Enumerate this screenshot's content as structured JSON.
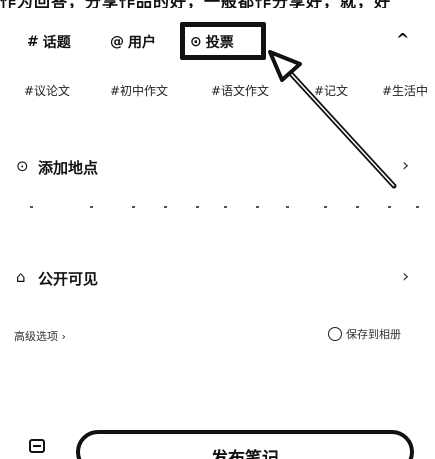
{
  "top_clip_text": "作为回答，分享作品的好，一般都作分享好，就，好",
  "toolbar": {
    "topic": {
      "icon": "#",
      "label": "话题"
    },
    "user": {
      "icon": "@",
      "label": "用户"
    },
    "vote": {
      "icon": "⊙",
      "label": "投票"
    },
    "collapse": "^"
  },
  "tags": [
    "#议论文",
    "#初中作文",
    "#语文作文",
    "#记文",
    "#生活中"
  ],
  "location": {
    "icon": "⊙",
    "label": "添加地点",
    "chevron": "›"
  },
  "visibility": {
    "icon": "⌂",
    "label": "公开可见",
    "chevron": "›"
  },
  "advanced": "高级选项 ›",
  "save_album": "保存到相册",
  "publish_label": "发布笔记",
  "colors": {
    "text": "#111111",
    "background": "#ffffff",
    "highlight_border": "#111111"
  }
}
